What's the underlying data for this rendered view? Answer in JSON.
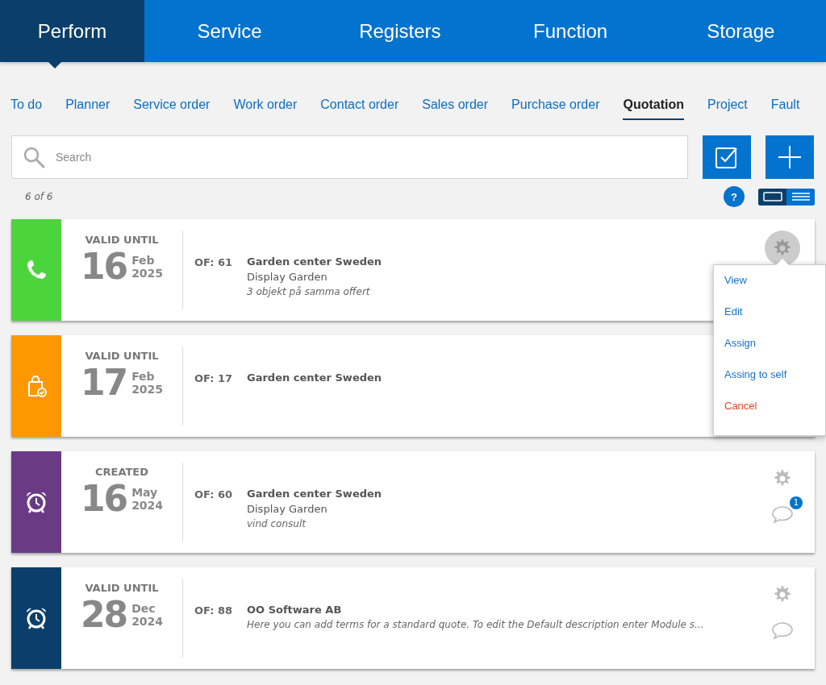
{
  "main_nav": [
    {
      "label": "Perform",
      "selected": true
    },
    {
      "label": "Service",
      "selected": false
    },
    {
      "label": "Registers",
      "selected": false
    },
    {
      "label": "Function",
      "selected": false
    },
    {
      "label": "Storage",
      "selected": false
    }
  ],
  "sub_nav": [
    {
      "label": "To do",
      "selected": false
    },
    {
      "label": "Planner",
      "selected": false
    },
    {
      "label": "Service order",
      "selected": false
    },
    {
      "label": "Work order",
      "selected": false
    },
    {
      "label": "Contact order",
      "selected": false
    },
    {
      "label": "Sales order",
      "selected": false
    },
    {
      "label": "Purchase order",
      "selected": false
    },
    {
      "label": "Quotation",
      "selected": true
    },
    {
      "label": "Project",
      "selected": false
    },
    {
      "label": "Fault",
      "selected": false
    }
  ],
  "search": {
    "placeholder": "Search"
  },
  "count": "6 of 6",
  "help": "?",
  "view_toggle": [
    {
      "kind": "card",
      "selected": true
    },
    {
      "kind": "list",
      "selected": false
    }
  ],
  "quotations": [
    {
      "kind": "phone",
      "color": "#4cd43d",
      "date_label": "VALID UNTIL",
      "day": "16",
      "month": "Feb",
      "year": "2025",
      "number": "OF: 61",
      "lines": [
        {
          "kind": "title",
          "text": "Garden center Sweden"
        },
        {
          "kind": "plain",
          "text": "Display Garden"
        },
        {
          "kind": "note",
          "text": "3 objekt på samma offert"
        }
      ],
      "menu_open": true
    },
    {
      "kind": "bag",
      "color": "#ff9800",
      "date_label": "VALID UNTIL",
      "day": "17",
      "month": "Feb",
      "year": "2025",
      "number": "OF: 17",
      "lines": [
        {
          "kind": "title",
          "text": "Garden center Sweden"
        }
      ],
      "menu_open": false
    },
    {
      "kind": "alarm",
      "color": "#6b3a86",
      "date_label": "CREATED",
      "day": "16",
      "month": "May",
      "year": "2024",
      "number": "OF: 60",
      "lines": [
        {
          "kind": "title",
          "text": "Garden center Sweden"
        },
        {
          "kind": "plain",
          "text": "Display Garden"
        },
        {
          "kind": "note",
          "text": "vind consult"
        }
      ],
      "menu_open": false,
      "comments": true,
      "comment_count": "1"
    },
    {
      "kind": "alarm",
      "color": "#0b3f6b",
      "date_label": "VALID UNTIL",
      "day": "28",
      "month": "Dec",
      "year": "2024",
      "number": "OF: 88",
      "lines": [
        {
          "kind": "title",
          "text": "OO Software AB"
        },
        {
          "kind": "note",
          "text": "Here you can add terms for a standard quote. To edit the Default description enter Module s..."
        }
      ],
      "menu_open": false,
      "comments": true
    }
  ],
  "action_menu": [
    {
      "kind": "normal",
      "label": "View"
    },
    {
      "kind": "normal",
      "label": "Edit"
    },
    {
      "kind": "normal",
      "label": "Assign"
    },
    {
      "kind": "normal",
      "label": "Assing to self"
    },
    {
      "kind": "danger",
      "label": "Cancel"
    }
  ]
}
